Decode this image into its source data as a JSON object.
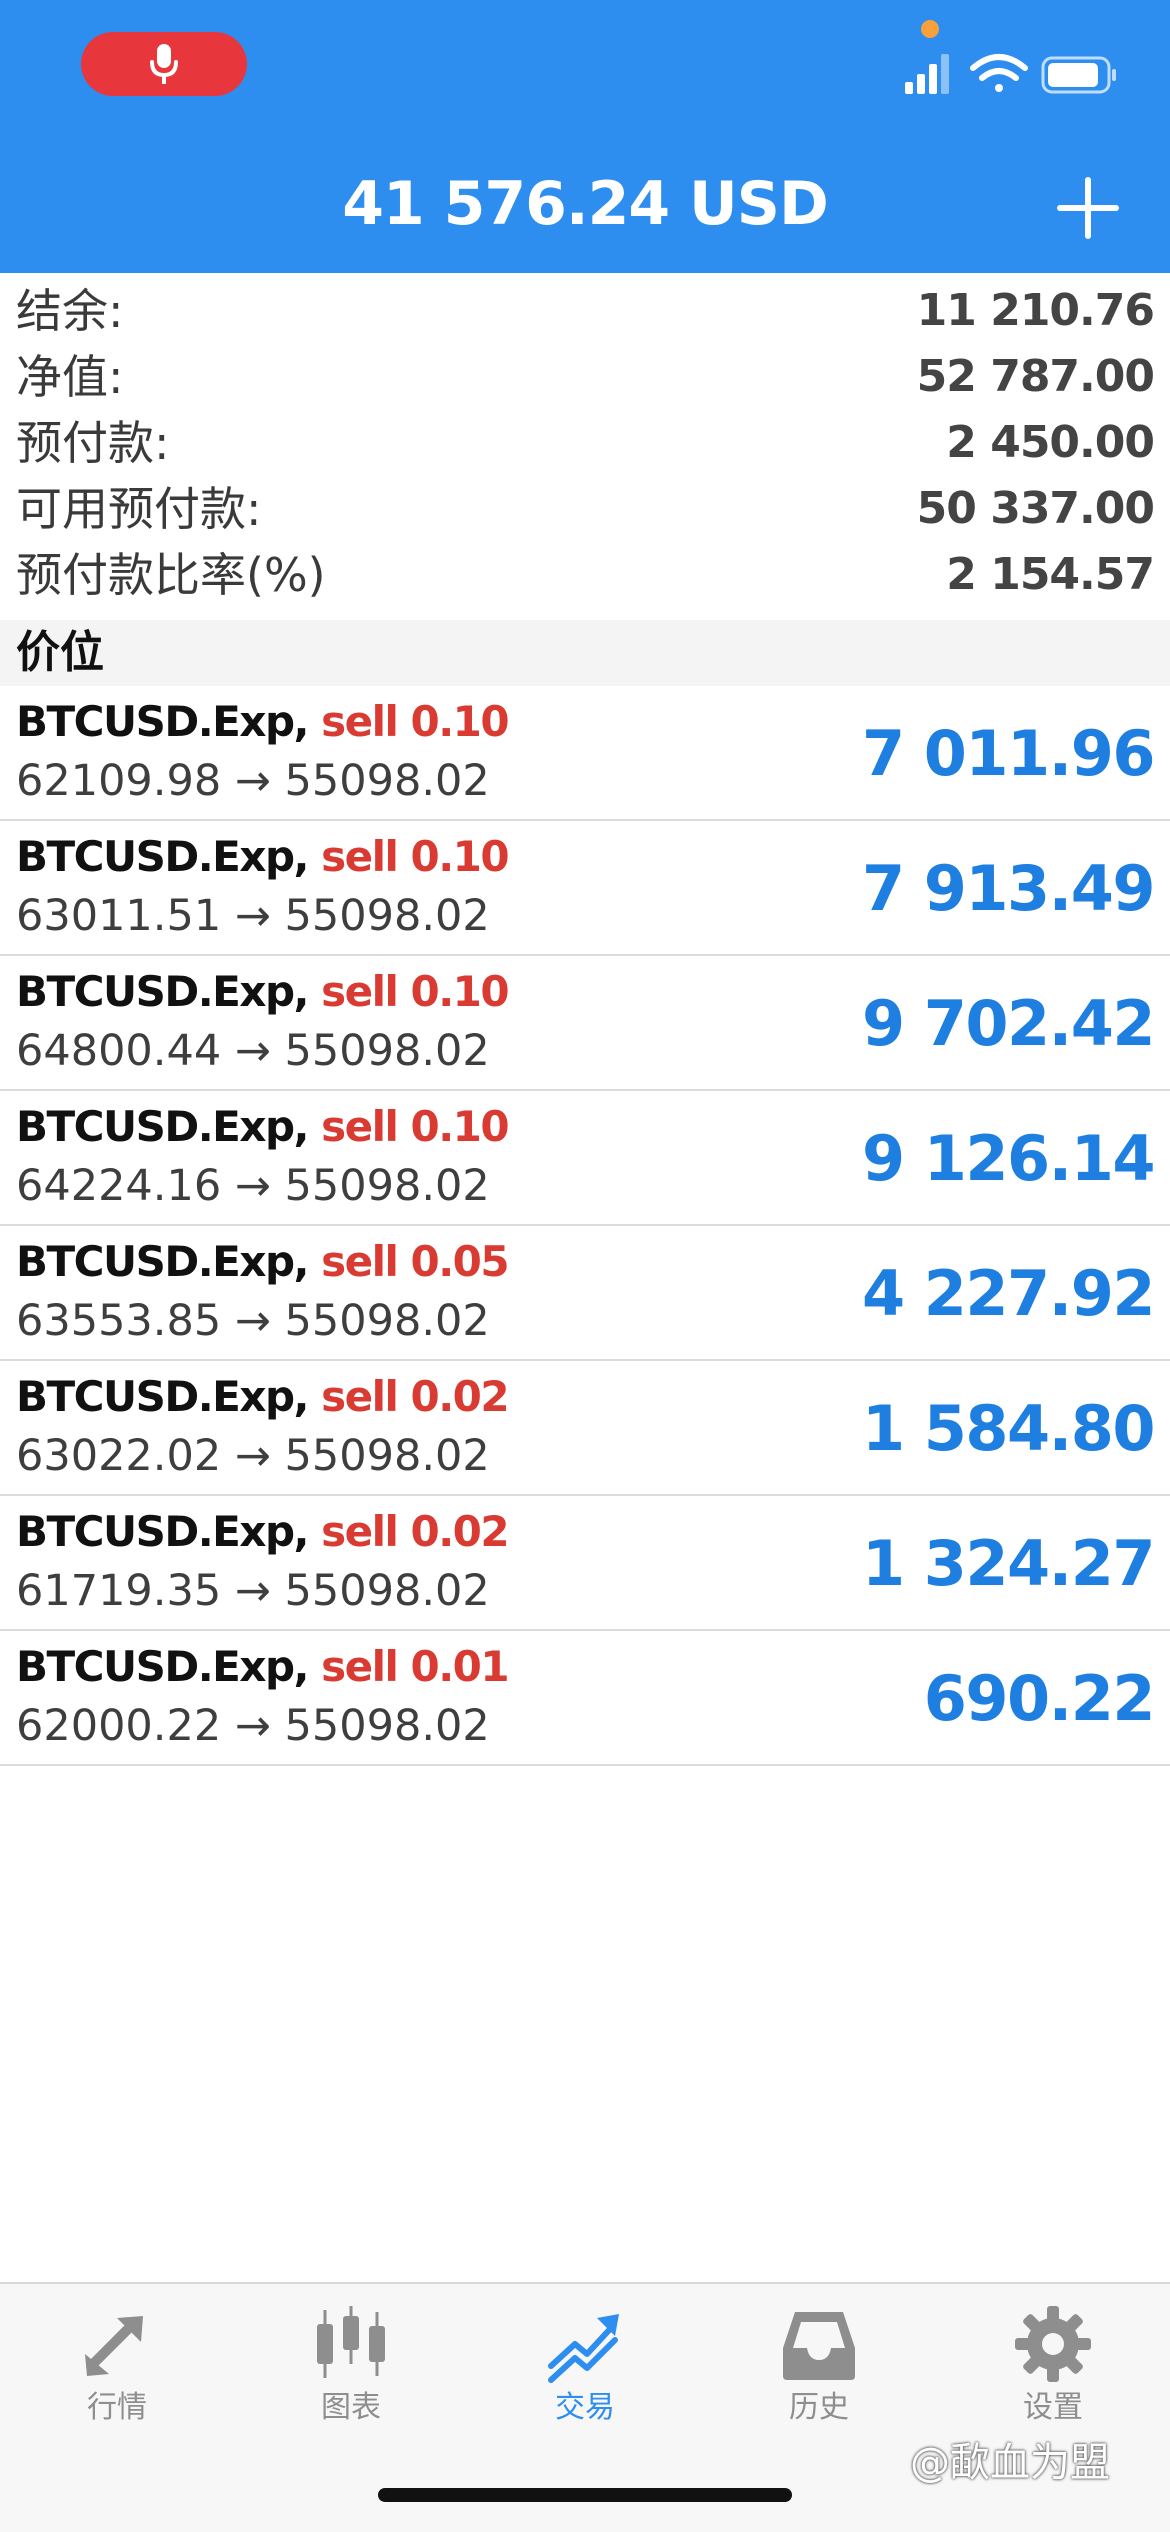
{
  "header": {
    "title": "41 576.24 USD",
    "colors": {
      "bar": "#2d8ef0",
      "mic_pill": "#e8373c"
    }
  },
  "summary": [
    {
      "label": "结余:",
      "value": "11 210.76"
    },
    {
      "label": "净值:",
      "value": "52 787.00"
    },
    {
      "label": "预付款:",
      "value": "2 450.00"
    },
    {
      "label": "可用预付款:",
      "value": "50 337.00"
    },
    {
      "label": "预付款比率(%)",
      "value": "2 154.57"
    }
  ],
  "section_title": "价位",
  "positions": [
    {
      "symbol": "BTCUSD.Exp,",
      "direction": "sell 0.10",
      "prices": "62109.98 → 55098.02",
      "profit": "7 011.96"
    },
    {
      "symbol": "BTCUSD.Exp,",
      "direction": "sell 0.10",
      "prices": "63011.51 → 55098.02",
      "profit": "7 913.49"
    },
    {
      "symbol": "BTCUSD.Exp,",
      "direction": "sell 0.10",
      "prices": "64800.44 → 55098.02",
      "profit": "9 702.42"
    },
    {
      "symbol": "BTCUSD.Exp,",
      "direction": "sell 0.10",
      "prices": "64224.16 → 55098.02",
      "profit": "9 126.14"
    },
    {
      "symbol": "BTCUSD.Exp,",
      "direction": "sell 0.05",
      "prices": "63553.85 → 55098.02",
      "profit": "4 227.92"
    },
    {
      "symbol": "BTCUSD.Exp,",
      "direction": "sell 0.02",
      "prices": "63022.02 → 55098.02",
      "profit": "1 584.80"
    },
    {
      "symbol": "BTCUSD.Exp,",
      "direction": "sell 0.02",
      "prices": "61719.35 → 55098.02",
      "profit": "1 324.27"
    },
    {
      "symbol": "BTCUSD.Exp,",
      "direction": "sell 0.01",
      "prices": "62000.22 → 55098.02",
      "profit": "690.22"
    }
  ],
  "tabs": [
    {
      "label": "行情",
      "icon": "quotes-arrows-icon"
    },
    {
      "label": "图表",
      "icon": "candlestick-chart-icon"
    },
    {
      "label": "交易",
      "icon": "trade-trend-icon",
      "active": true
    },
    {
      "label": "历史",
      "icon": "history-inbox-icon"
    },
    {
      "label": "设置",
      "icon": "settings-gear-icon"
    }
  ],
  "watermark": "@歃血为盟",
  "colors": {
    "profit": "#1e7fe0",
    "sell": "#d93a32",
    "active_tab": "#2d8ef0",
    "inactive_tab": "#8e8e8e"
  }
}
